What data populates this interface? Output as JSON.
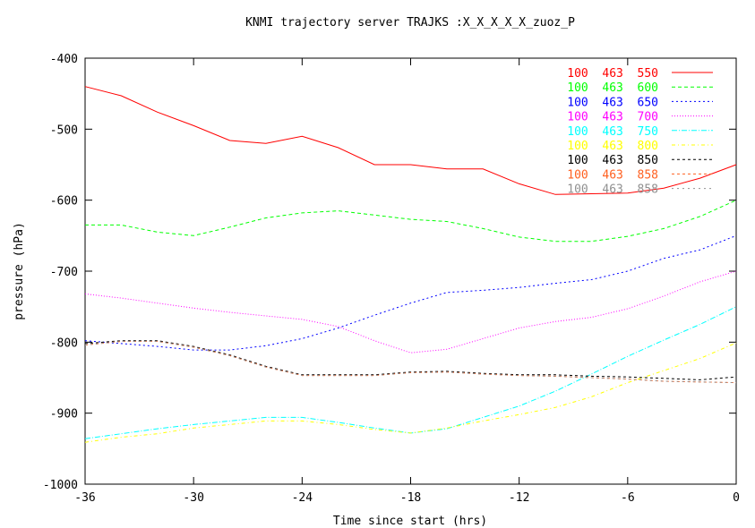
{
  "chart_data": {
    "type": "line",
    "title": "KNMI trajectory server TRAJKS :X_X_X_X_X_zuoz_P",
    "xlabel": "Time since start (hrs)",
    "ylabel": "pressure (hPa)",
    "xlim": [
      -36,
      0
    ],
    "ylim": [
      -1000,
      -400
    ],
    "xticks": [
      -36,
      -30,
      -24,
      -18,
      -12,
      -6,
      0
    ],
    "yticks": [
      -400,
      -500,
      -600,
      -700,
      -800,
      -900,
      -1000
    ],
    "grid": false,
    "legend_position": "top-right",
    "x": [
      -36,
      -34,
      -32,
      -30,
      -28,
      -26,
      -24,
      -22,
      -20,
      -18,
      -16,
      -14,
      -12,
      -10,
      -8,
      -6,
      -4,
      -2,
      0
    ],
    "series": [
      {
        "name": "100  463  550",
        "color": "#ff0000",
        "dash": "",
        "values": [
          -440,
          -453,
          -476,
          -495,
          -516,
          -520,
          -510,
          -526,
          -550,
          -550,
          -556,
          -556,
          -577,
          -592,
          -591,
          -590,
          -583,
          -569,
          -550
        ]
      },
      {
        "name": "100  463  600",
        "color": "#00ff00",
        "dash": "4,3",
        "values": [
          -635,
          -635,
          -645,
          -650,
          -638,
          -625,
          -618,
          -615,
          -621,
          -627,
          -630,
          -640,
          -652,
          -658,
          -658,
          -651,
          -640,
          -623,
          -600
        ]
      },
      {
        "name": "100  463  650",
        "color": "#0000ff",
        "dash": "2,3",
        "values": [
          -798,
          -802,
          -806,
          -811,
          -811,
          -805,
          -795,
          -780,
          -762,
          -745,
          -730,
          -727,
          -723,
          -717,
          -712,
          -700,
          -682,
          -670,
          -650
        ]
      },
      {
        "name": "100  463  700",
        "color": "#ff00ff",
        "dash": "1,2",
        "values": [
          -732,
          -738,
          -745,
          -752,
          -758,
          -763,
          -768,
          -778,
          -798,
          -815,
          -810,
          -795,
          -780,
          -771,
          -765,
          -753,
          -735,
          -715,
          -700
        ]
      },
      {
        "name": "100  463  750",
        "color": "#00ffff",
        "dash": "6,2,1,2",
        "values": [
          -936,
          -929,
          -922,
          -916,
          -911,
          -906,
          -906,
          -913,
          -921,
          -928,
          -922,
          -906,
          -890,
          -869,
          -845,
          -820,
          -797,
          -775,
          -750
        ]
      },
      {
        "name": "100  463  800",
        "color": "#ffff00",
        "dash": "4,3,1,3",
        "values": [
          -941,
          -934,
          -929,
          -921,
          -916,
          -911,
          -911,
          -916,
          -923,
          -928,
          -921,
          -911,
          -902,
          -892,
          -877,
          -857,
          -840,
          -823,
          -801
        ]
      },
      {
        "name": "100  463  850",
        "color": "#000000",
        "dash": "3,3",
        "values": [
          -802,
          -798,
          -798,
          -806,
          -818,
          -834,
          -846,
          -846,
          -846,
          -842,
          -841,
          -844,
          -846,
          -846,
          -848,
          -849,
          -851,
          -853,
          -849
        ]
      },
      {
        "name": "100  463  858",
        "color": "#ff6020",
        "dash": "3,3",
        "values": [
          -804,
          -799,
          -799,
          -807,
          -819,
          -835,
          -847,
          -847,
          -847,
          -843,
          -842,
          -845,
          -847,
          -848,
          -850,
          -852,
          -855,
          -856,
          -857
        ]
      },
      {
        "name": "100  463  858",
        "color": "#909090",
        "dash": "2,4",
        "values": [
          -804,
          -799,
          -799,
          -807,
          -819,
          -835,
          -847,
          -847,
          -847,
          -843,
          -842,
          -845,
          -847,
          -848,
          -850,
          -852,
          -855,
          -856,
          -857
        ]
      }
    ]
  }
}
